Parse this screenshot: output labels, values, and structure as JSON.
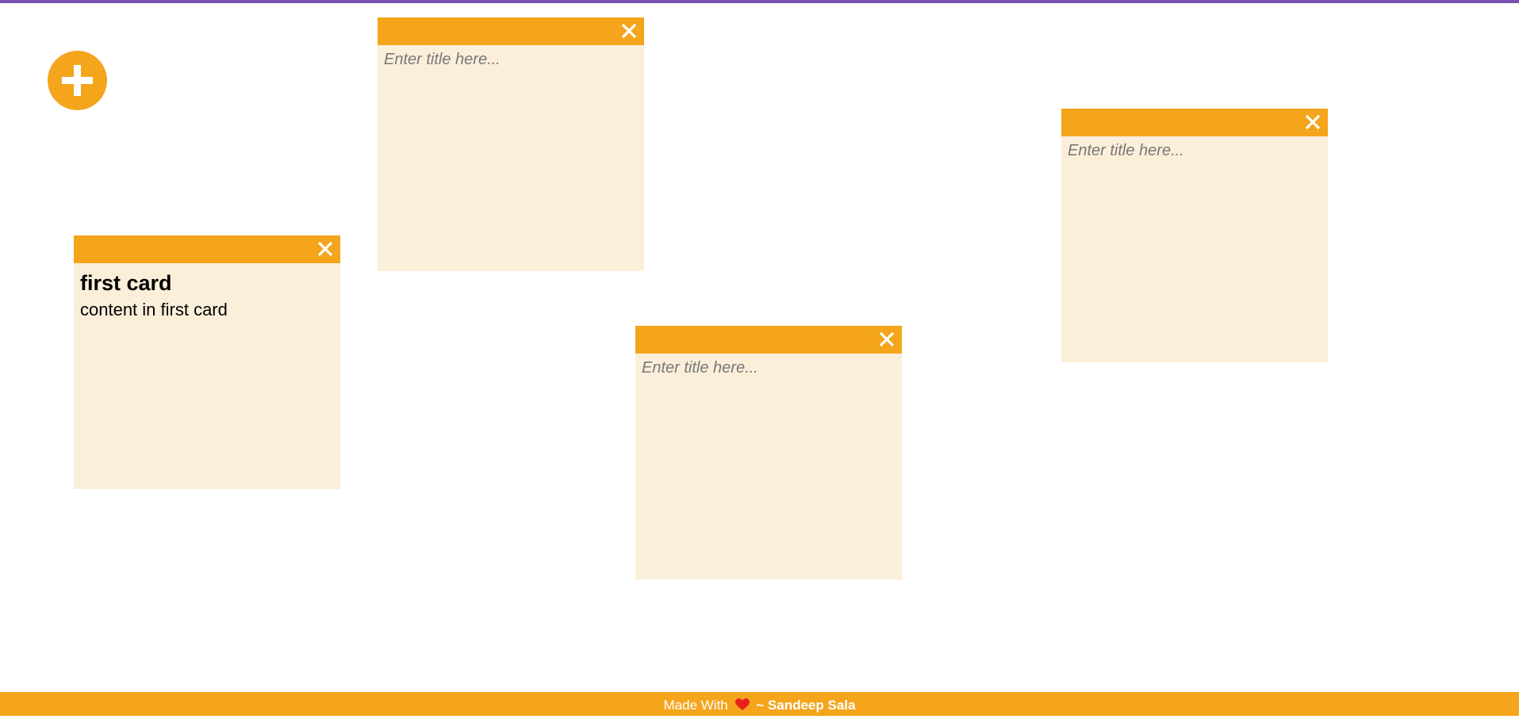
{
  "colors": {
    "accent": "#f4a51c",
    "note_background": "#fbefda",
    "top_bar": "#7b4fb0",
    "heart": "#e8211d"
  },
  "add_button": {
    "icon": "plus-icon"
  },
  "notes": [
    {
      "title": "first card",
      "content": "content in first card",
      "close_icon": "close-icon"
    },
    {
      "title_placeholder": "Enter title here...",
      "close_icon": "close-icon"
    },
    {
      "title_placeholder": "Enter title here...",
      "close_icon": "close-icon"
    },
    {
      "title_placeholder": "Enter title here...",
      "close_icon": "close-icon"
    }
  ],
  "footer": {
    "made_with": "Made With",
    "heart_icon": "heart-icon",
    "separator": "~",
    "author": "Sandeep Sala"
  }
}
